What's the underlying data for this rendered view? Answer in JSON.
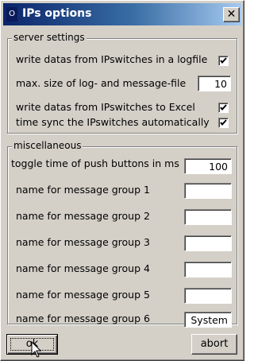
{
  "window": {
    "title": "IPs options",
    "icon_glyph": "O",
    "close_glyph": "✕"
  },
  "server_settings": {
    "title": "server settings",
    "logfile_label": "write datas from IPswitches in a logfile",
    "logfile_checked": true,
    "max_size_label": "max. size of log- and message-file",
    "max_size_value": "10",
    "excel_label": "write datas from IPswitches to Excel",
    "excel_checked": true,
    "timesync_label": "time sync the IPswitches automatically",
    "timesync_checked": true
  },
  "miscellaneous": {
    "title": "miscellaneous",
    "toggle_label": "toggle time of push buttons in ms",
    "toggle_value": "100",
    "groups": [
      {
        "label": "name for message group 1",
        "value": ""
      },
      {
        "label": "name for message group 2",
        "value": ""
      },
      {
        "label": "name for message group 3",
        "value": ""
      },
      {
        "label": "name for message group 4",
        "value": ""
      },
      {
        "label": "name for message group 5",
        "value": ""
      },
      {
        "label": "name for message group 6",
        "value": "System"
      }
    ]
  },
  "buttons": {
    "ok_label": "ok",
    "abort_label": "abort"
  }
}
